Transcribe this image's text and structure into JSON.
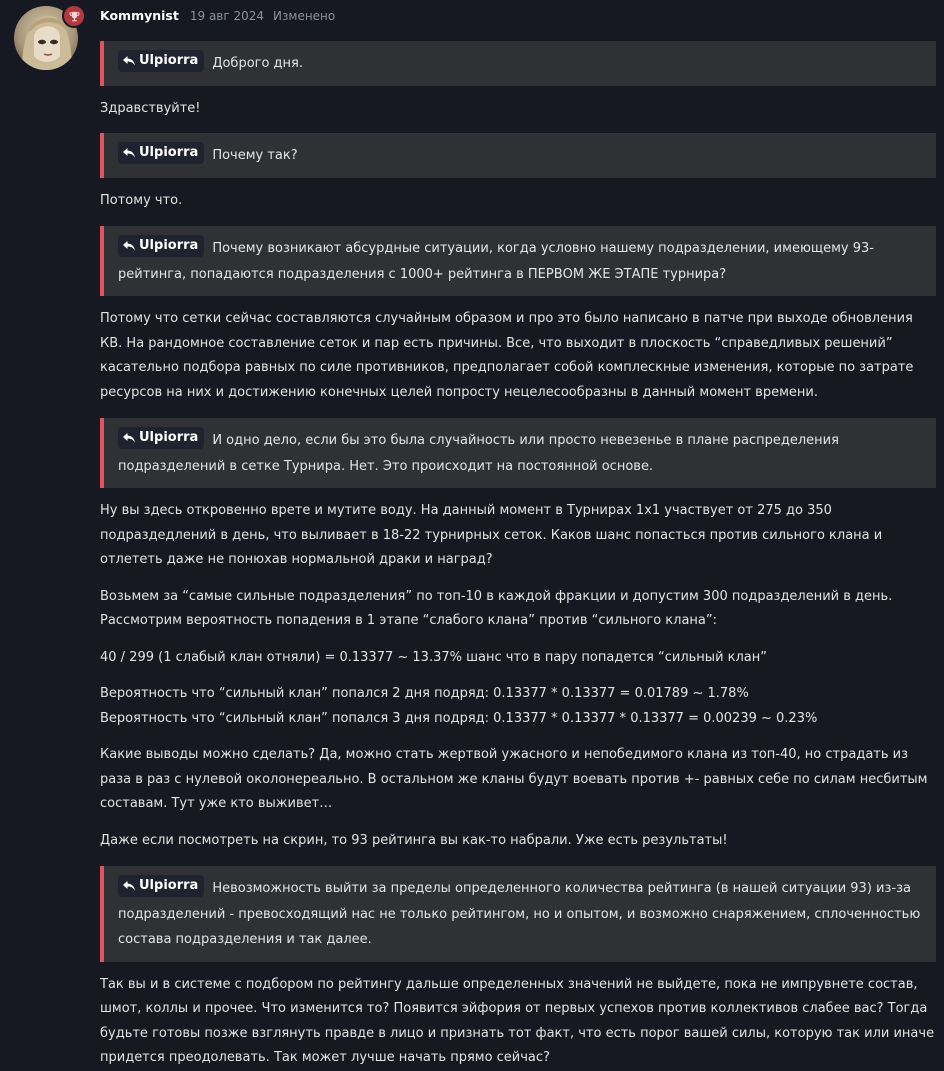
{
  "author": "Kommynist",
  "date": "19 авг 2024",
  "edited": "Изменено",
  "blocks": [
    {
      "type": "quote",
      "user": "Ulpiorra",
      "text": "Доброго дня."
    },
    {
      "type": "para",
      "text": "Здравствуйте!"
    },
    {
      "type": "quote",
      "user": "Ulpiorra",
      "text": "Почему так?"
    },
    {
      "type": "para",
      "text": "Потому что."
    },
    {
      "type": "quote",
      "user": "Ulpiorra",
      "text": "Почему возникают абсурдные ситуации, когда условно нашему подразделении, имеющему 93-рейтинга, попадаются подразделения с 1000+ рейтинга в ПЕРВОМ ЖЕ ЭТАПЕ турнира?"
    },
    {
      "type": "para",
      "text": "Потому что сетки сейчас составляются случайным образом и про это было написано в патче при выходе обновления КВ. На рандомное составление сеток и пар есть причины. Все, что выходит в плоскость “справедливых решений” касательно подбора равных по силе противников, предполагает собой комплескные изменения, которые по затрате ресурсов на них и достижению конечных целей попросту нецелесообразны в данный момент времени."
    },
    {
      "type": "quote",
      "user": "Ulpiorra",
      "text": "И одно дело, если бы это была случайность или просто невезенье в плане распределения подразделений в сетке Турнира. Нет. Это происходит на постоянной основе."
    },
    {
      "type": "para",
      "text": "Ну вы здесь откровенно врете и мутите воду. На данный момент в Турнирах 1x1 участвует от 275 до 350 подраздедлений в день, что выливает в 18-22 турнирных сеток. Каков шанс попасться против сильного клана и отлететь даже не понюхав нормальной драки и наград?"
    },
    {
      "type": "para",
      "text": "Возьмем за “самые сильные подразделения” по топ-10 в каждой фракции и допустим 300 подразделений в день. Рассмотрим вероятность попадения в 1 этапе “слабого клана” против “сильного клана”:"
    },
    {
      "type": "para",
      "text": "40 / 299 (1 слабый клан отняли) = 0.13377 ~ 13.37% шанс что в пару попадется “сильный клан”"
    },
    {
      "type": "para2",
      "line1": "Вероятность что “сильный клан” попался 2 дня подряд: 0.13377 * 0.13377 = 0.01789 ~ 1.78%",
      "line2": "Вероятность что “сильный клан” попался 3 дня подряд: 0.13377 * 0.13377 * 0.13377 = 0.00239 ~ 0.23%"
    },
    {
      "type": "para",
      "text": "Какие выводы можно сделать? Да, можно стать жертвой ужасного и непобедимого клана из топ-40, но страдать из раза в раз с нулевой околонереально. В остальном же кланы будут воевать против +- равных себе по силам несбитым составам. Тут уже кто выживет…"
    },
    {
      "type": "para",
      "text": "Даже если посмотреть на скрин, то 93 рейтинга вы как-то набрали. Уже есть результаты!"
    },
    {
      "type": "quote",
      "user": "Ulpiorra",
      "text": "Невозможность выйти за пределы определенного количества рейтинга (в нашей ситуации 93) из-за подразделений - превосходящий нас не только рейтингом, но и опытом, и возможно снаряжением, сплоченностью состава подразделения и так далее."
    },
    {
      "type": "para",
      "text": "Так вы и в системе с подбором по рейтингу дальше определенных значений не выйдете, пока не импрувнете состав, шмот, коллы и прочее. Что изменится то? Появится эйфория от первых успехов против коллективов слабее вас? Тогда будьте готовы позже взглянуть правде в лицо и признать тот факт, что есть порог вашей силы, которую так или иначе придется преодолевать. Так может лучше начать прямо сейчас?"
    }
  ]
}
